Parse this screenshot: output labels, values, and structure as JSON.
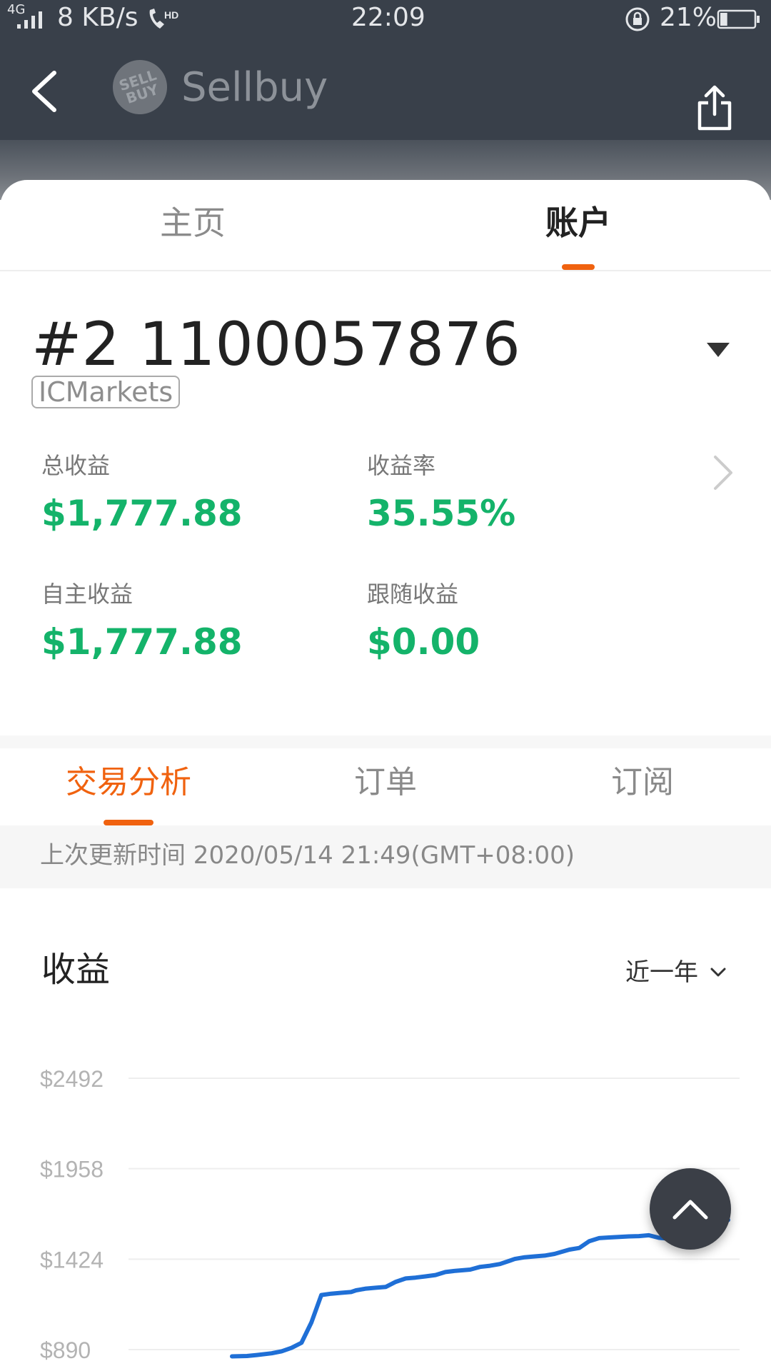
{
  "status_bar": {
    "signal": "4G",
    "speed": "8 KB/s",
    "call_icon": "volte-hd-icon",
    "time": "22:09",
    "rotation_lock_icon": "rotation-lock-icon",
    "battery": "21%",
    "battery_level": 0.21
  },
  "header": {
    "logo_text": "SELL BUY",
    "title": "Sellbuy",
    "back_icon": "back-arrow-icon",
    "share_icon": "share-icon"
  },
  "top_tabs": [
    {
      "label": "主页",
      "active": false
    },
    {
      "label": "账户",
      "active": true
    }
  ],
  "account": {
    "number": "#2 1100057876",
    "broker": "ICMarkets",
    "dropdown_icon": "caret-down-icon"
  },
  "stats": {
    "total_profit": {
      "label": "总收益",
      "value": "$1,777.88"
    },
    "return_rate": {
      "label": "收益率",
      "value": "35.55%"
    },
    "own_profit": {
      "label": "自主收益",
      "value": "$1,777.88"
    },
    "follow_profit": {
      "label": "跟随收益",
      "value": "$0.00"
    },
    "more_icon": "chevron-right-icon"
  },
  "sub_tabs": [
    {
      "label": "交易分析",
      "active": true
    },
    {
      "label": "订单",
      "active": false
    },
    {
      "label": "订阅",
      "active": false
    }
  ],
  "update": {
    "label": "上次更新时间 2020/05/14 21:49(GMT+08:00)"
  },
  "chart_section": {
    "title": "收益",
    "range": "近一年",
    "range_icon": "chevron-down-icon",
    "scroll_top_icon": "arrow-up-icon"
  },
  "colors": {
    "accent": "#f0620f",
    "profit": "#14b36a",
    "line": "#1f6fd6",
    "header": "#39404a"
  },
  "chart_data": {
    "type": "line",
    "title": "",
    "xlabel": "",
    "ylabel": "",
    "y_ticks": [
      "$2492",
      "$1958",
      "$1424",
      "$890"
    ],
    "y_tick_values": [
      2492,
      1958,
      1424,
      890
    ],
    "ylim": [
      890,
      2492
    ],
    "grid": true,
    "x": [
      0,
      3,
      5,
      8,
      10,
      12,
      14,
      16,
      18,
      20,
      22,
      24,
      25,
      26,
      27,
      29,
      31,
      33,
      35,
      37,
      39,
      41,
      43,
      45,
      48,
      50,
      52,
      54,
      56,
      57,
      59,
      61,
      63,
      65,
      68,
      70,
      72,
      74,
      76,
      78,
      80,
      82,
      84,
      86,
      88,
      90,
      92,
      94,
      95,
      96,
      98,
      100
    ],
    "series": [
      {
        "values": [
          850,
          852,
          858,
          868,
          880,
          900,
          930,
          1050,
          1212,
          1220,
          1225,
          1230,
          1240,
          1245,
          1250,
          1255,
          1260,
          1290,
          1310,
          1315,
          1322,
          1330,
          1348,
          1355,
          1362,
          1378,
          1385,
          1395,
          1415,
          1425,
          1435,
          1440,
          1445,
          1455,
          1480,
          1490,
          1530,
          1548,
          1552,
          1555,
          1558,
          1560,
          1565,
          1550,
          1545,
          1600,
          1635,
          1645,
          1648,
          1650,
          1652,
          1655
        ]
      }
    ]
  }
}
